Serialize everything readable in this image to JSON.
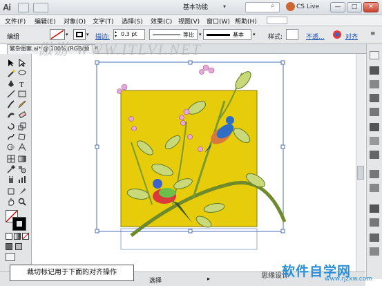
{
  "app": {
    "logo": "Ai",
    "workspace": "基本功能",
    "cslive": "CS Live"
  },
  "window": {
    "minimize": "—",
    "maximize": "□",
    "close": "✕"
  },
  "menu": {
    "items": [
      "文件(F)",
      "编辑(E)",
      "对象(O)",
      "文字(T)",
      "选择(S)",
      "效果(C)",
      "视图(V)",
      "窗口(W)",
      "帮助(H)"
    ]
  },
  "control": {
    "group_label": "编组",
    "stroke_label": "描边:",
    "stroke_value": "0.3 pt",
    "profile": "等比",
    "brush": "基本",
    "style_label": "样式:",
    "opacity_label": "不透...",
    "align_label": "对齐"
  },
  "document": {
    "tab": "繁杂图案.ai* @ 100% (RGB/预览)"
  },
  "status": {
    "selection": "选择"
  },
  "caption": "裁切标记用于下面的对齐操作",
  "watermark": {
    "top": "傲游 WWW.ITLVI.NET",
    "site_name": "软件自学网",
    "site_domain": "www.rjzxw.com",
    "bottom_left": "思缘设计"
  },
  "colors": {
    "art_background": "#E6CC0B",
    "selection": "#4B6DB8",
    "accent": "#2A8FD6"
  }
}
